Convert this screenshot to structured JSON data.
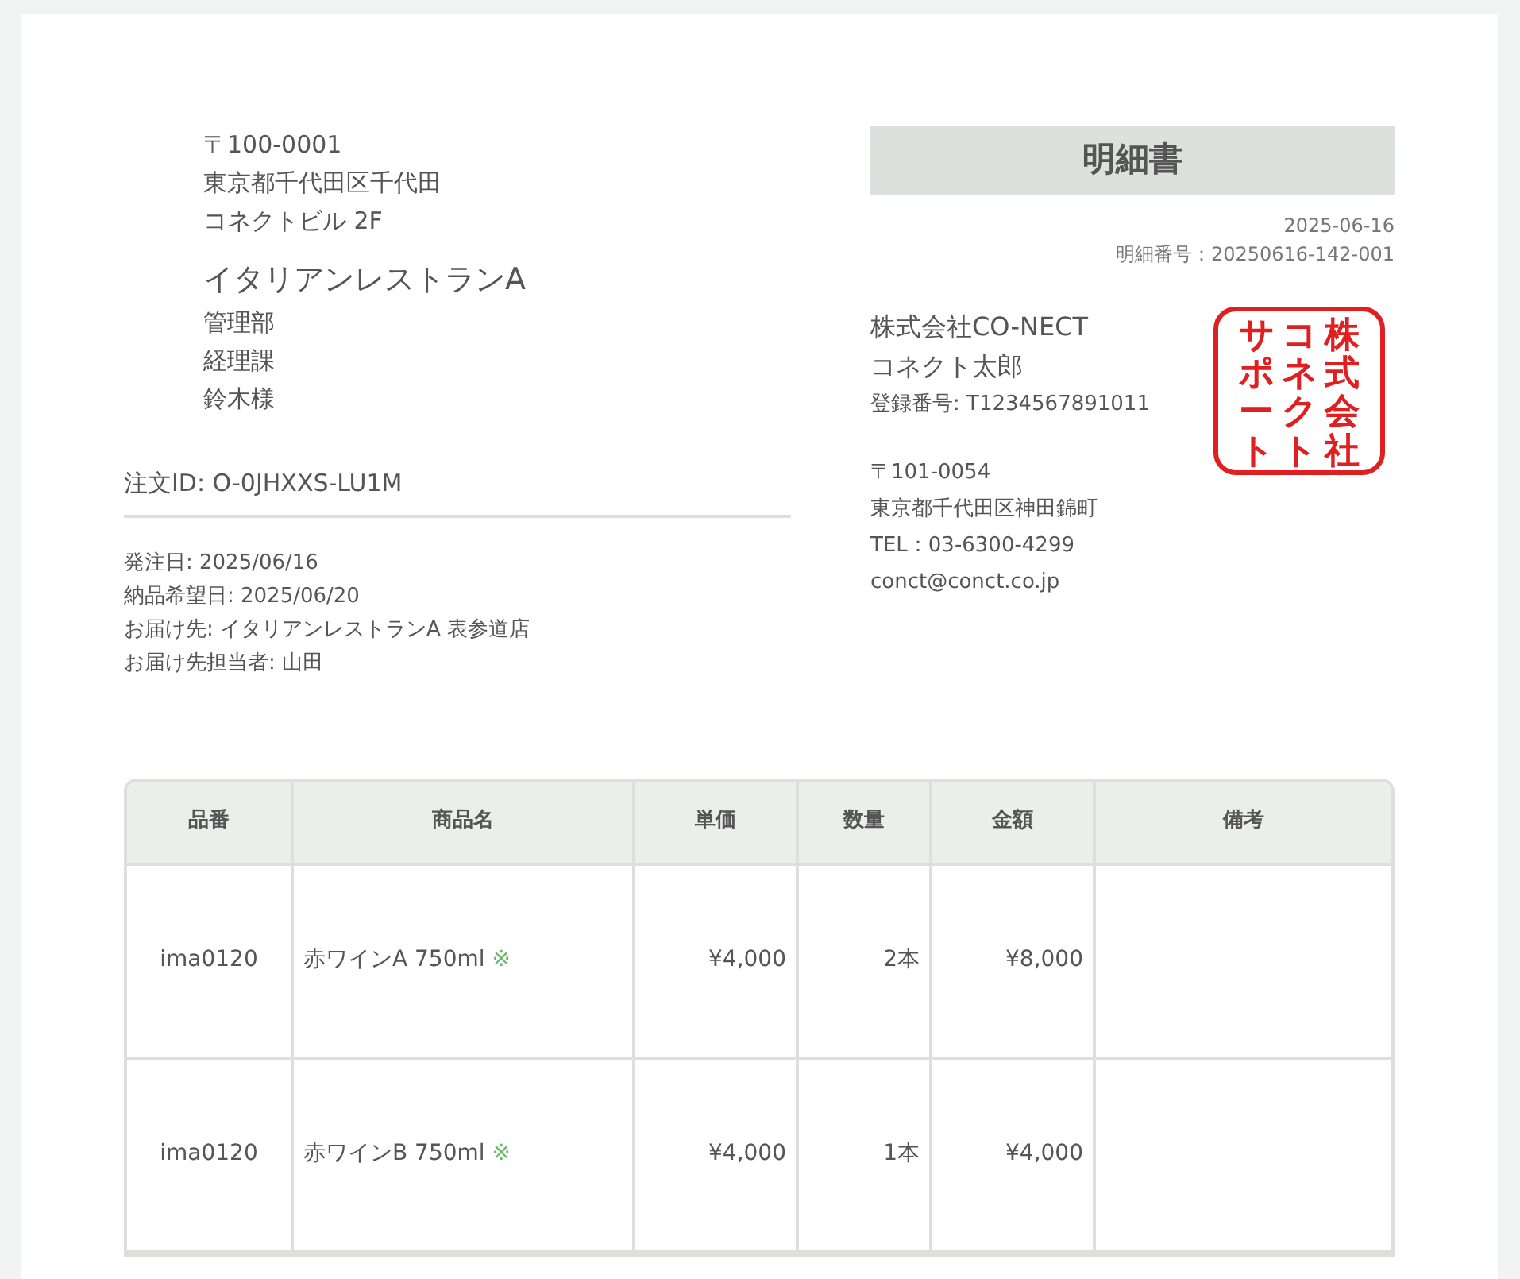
{
  "recipient": {
    "address_lines": [
      "〒100-0001",
      "東京都千代田区千代田",
      "コネクトビル 2F"
    ],
    "company": "イタリアンレストランA",
    "lines": [
      "管理部",
      "経理課",
      "鈴木様"
    ]
  },
  "order_id": "注文ID: O-0JHXXS-LU1M",
  "order_details": [
    "発注日: 2025/06/16",
    "納品希望日: 2025/06/20",
    "お届け先: イタリアンレストランA 表参道店",
    "お届け先担当者: 山田"
  ],
  "document": {
    "title": "明細書",
    "date": "2025-06-16",
    "number": "明細番号：20250616-142-001"
  },
  "issuer": {
    "company": "株式会社CO-NECT",
    "person": "コネクト太郎",
    "registration": "登録番号: T1234567891011",
    "postal": "〒101-0054",
    "address": "東京都千代田区神田錦町",
    "tel": "TEL：03-6300-4299",
    "email": "conct@conct.co.jp"
  },
  "stamp": {
    "columns": [
      "サポート",
      "コネクト",
      "株式会社"
    ]
  },
  "table": {
    "columns": [
      "品番",
      "商品名",
      "単価",
      "数量",
      "金額",
      "備考"
    ],
    "rows": [
      {
        "code": "ima0120",
        "name": "赤ワインA 750ml",
        "mark": "※",
        "unit_price": "¥4,000",
        "quantity": "2本",
        "amount": "¥8,000"
      },
      {
        "code": "ima0120",
        "name": "赤ワインB 750ml",
        "mark": "※",
        "unit_price": "¥4,000",
        "quantity": "1本",
        "amount": "¥4,000"
      }
    ]
  }
}
